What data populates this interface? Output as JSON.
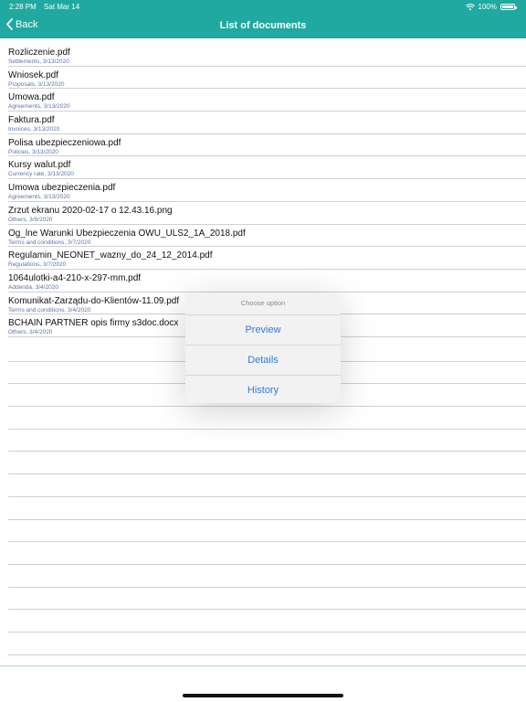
{
  "status_bar": {
    "time": "2:28 PM",
    "date": "Sat Mar 14",
    "battery": "100%",
    "battery_level": 1.0
  },
  "nav": {
    "back_label": "Back",
    "title": "List of documents"
  },
  "documents": [
    {
      "name": "Rozliczenie.pdf",
      "meta": "Settlements, 3/13/2020"
    },
    {
      "name": "Wniosek.pdf",
      "meta": "Proposals, 3/13/2020"
    },
    {
      "name": "Umowa.pdf",
      "meta": "Agreements, 3/13/2020"
    },
    {
      "name": "Faktura.pdf",
      "meta": "Invoices, 3/13/2020"
    },
    {
      "name": "Polisa ubezpieczeniowa.pdf",
      "meta": "Policies, 3/13/2020"
    },
    {
      "name": "Kursy walut.pdf",
      "meta": "Currency rate, 3/13/2020"
    },
    {
      "name": "Umowa ubezpieczenia.pdf",
      "meta": "Agreements, 3/13/2020"
    },
    {
      "name": "Zrzut ekranu 2020-02-17 o 12.43.16.png",
      "meta": "Others, 3/9/2020"
    },
    {
      "name": "Og_lne Warunki Ubezpieczenia OWU_ULS2_1A_2018.pdf",
      "meta": "Terms and conditions, 3/7/2020"
    },
    {
      "name": "Regulamin_NEONET_wazny_do_24_12_2014.pdf",
      "meta": "Regulations, 3/7/2020"
    },
    {
      "name": "1064ulotki-a4-210-x-297-mm.pdf",
      "meta": "Addenda, 3/4/2020"
    },
    {
      "name": "Komunikat-Zarządu-do-Klientów-11.09.pdf",
      "meta": "Terms and conditions, 3/4/2020"
    },
    {
      "name": "BCHAIN PARTNER opis firmy s3doc.docx",
      "meta": "Others, 3/4/2020"
    }
  ],
  "popover": {
    "title": "Choose option",
    "options": [
      "Preview",
      "Details",
      "History"
    ]
  },
  "colors": {
    "header": "#1fa9a0",
    "link": "#2f7cd6",
    "meta": "#5a74a8"
  }
}
